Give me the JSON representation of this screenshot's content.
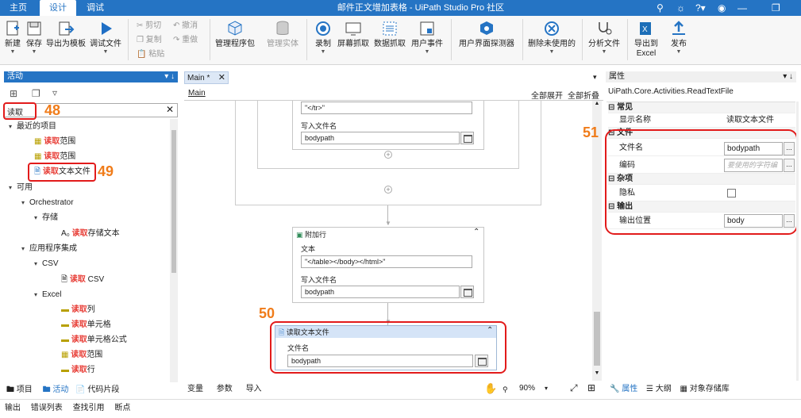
{
  "titlebar": {
    "tabs": [
      "主页",
      "设计",
      "调试"
    ],
    "title": "邮件正文增加表格 - UiPath Studio Pro 社区"
  },
  "ribbon": {
    "new": "新建",
    "save": "保存",
    "export_template": "导出为模板",
    "debug_file": "调试文件",
    "cut": "剪切",
    "undo": "撤消",
    "copy": "复制",
    "redo": "重做",
    "paste": "粘贴",
    "manage_packages": "管理程序包",
    "manage_entities": "管理实体",
    "record": "录制",
    "screen_scraping": "屏幕抓取",
    "data_scraping": "数据抓取",
    "user_events": "用户事件",
    "ui_explorer": "用户界面探测器",
    "remove_unused": "删除未使用的",
    "analyze_file": "分析文件",
    "export_excel_1": "导出到",
    "export_excel_2": "Excel",
    "publish": "发布"
  },
  "activities": {
    "header": "活动",
    "search_value": "读取",
    "recent": "最近的项目",
    "available": "可用",
    "items": [
      {
        "hl": "读取",
        "rest": "范围"
      },
      {
        "hl": "读取",
        "rest": "范围"
      },
      {
        "hl": "读取",
        "rest": "文本文件"
      }
    ],
    "orchestrator": "Orchestrator",
    "storage": "存储",
    "storage_item": {
      "hl": "读取",
      "rest": "存储文本"
    },
    "app_integration": "应用程序集成",
    "csv": "CSV",
    "csv_item": {
      "hl": "读取",
      "rest": " CSV"
    },
    "excel": "Excel",
    "excel_items": [
      {
        "hl": "读取",
        "rest": "列"
      },
      {
        "hl": "读取",
        "rest": "单元格"
      },
      {
        "hl": "读取",
        "rest": "单元格公式"
      },
      {
        "hl": "读取",
        "rest": "范围"
      },
      {
        "hl": "读取",
        "rest": "行"
      }
    ],
    "bottom_tabs": [
      "项目",
      "活动",
      "代码片段"
    ]
  },
  "designer": {
    "tab": "Main *",
    "breadcrumb": "Main",
    "expand_all": "全部展开",
    "collapse_all": "全部折叠",
    "top_text_value": "\"</tr>\"",
    "write_file_label": "写入文件名",
    "top_path_value": "bodypath",
    "append_title": "附加行",
    "text_label": "文本",
    "append_text_value": "\"</table></body></html>\"",
    "append_write_label": "写入文件名",
    "append_path_value": "bodypath",
    "read_title": "读取文本文件",
    "read_file_label": "文件名",
    "read_path_value": "bodypath",
    "bottom_tabs": [
      "变量",
      "参数",
      "导入"
    ],
    "zoom": "90%"
  },
  "properties": {
    "header": "属性",
    "type": "UiPath.Core.Activities.ReadTextFile",
    "common": "常见",
    "display_name_label": "显示名称",
    "display_name_value": "读取文本文件",
    "file": "文件",
    "filename_label": "文件名",
    "filename_value": "bodypath",
    "encoding_label": "编码",
    "encoding_placeholder": "要使用的字符编",
    "misc": "杂项",
    "private_label": "隐私",
    "output": "输出",
    "output_label": "输出位置",
    "output_value": "body",
    "bottom_tabs": [
      "属性",
      "大纲",
      "对象存储库"
    ]
  },
  "statusbar": [
    "输出",
    "错误列表",
    "查找引用",
    "断点"
  ],
  "annotations": [
    "48",
    "49",
    "50",
    "51"
  ]
}
